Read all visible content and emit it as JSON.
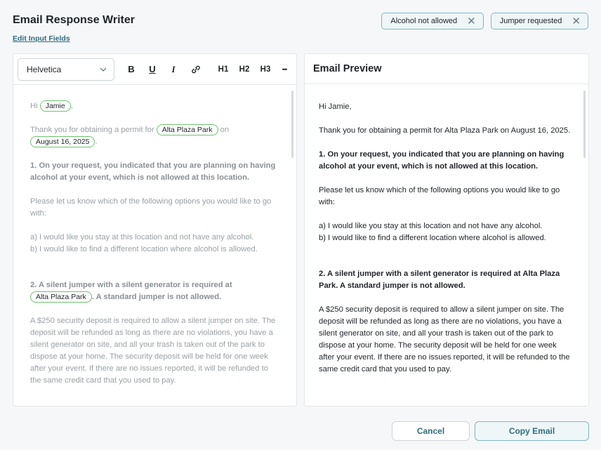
{
  "header": {
    "title": "Email Response Writer",
    "edit_link": "Edit Input Fields"
  },
  "chips": [
    {
      "label": "Alcohol not allowed"
    },
    {
      "label": "Jumper requested"
    }
  ],
  "editor": {
    "font": "Helvetica",
    "tools": {
      "bold": "B",
      "underline": "U",
      "italic": "I",
      "h1": "H1",
      "h2": "H2",
      "h3": "H3",
      "more": "•••"
    },
    "greeting_prefix": "Hi",
    "name_token": "Jamie",
    "greeting_suffix": ",",
    "intro_prefix": "Thank you for obtaining a permit for",
    "park_token": "Alta Plaza Park",
    "intro_mid": "on",
    "date_token": "August 16, 2025",
    "intro_suffix": ".",
    "item1": "1.  On your request, you indicated that you are planning on having alcohol at your event, which is not allowed at this location.",
    "options_intro": "Please let us know which of the following options you would like to go with:",
    "option_a": "a)  I would like you stay at this location and not have any alcohol.",
    "option_b": "b)  I would like to find a different location where alcohol is allowed.",
    "item2_prefix": "2.  A silent jumper with a silent generator is required at",
    "item2_park_token": "Alta Plaza Park",
    "item2_suffix": ".  A standard jumper is not allowed.",
    "deposit": "A $250 security deposit is required to allow a silent jumper on site. The deposit will be refunded as long as there are no violations, you have a silent generator on site, and all your trash is taken out of the park to dispose at your home. The security deposit will be held for one week after your event. If there are no issues reported, it will be refunded to the same credit card that you used to pay."
  },
  "preview": {
    "title": "Email Preview",
    "greeting": "Hi Jamie,",
    "intro": "Thank you for obtaining a permit for Alta Plaza Park on August 16, 2025.",
    "item1": "1.  On your request, you indicated that you are planning on having alcohol at your event, which is not allowed at this location.",
    "options_intro": "Please let us know which of the following options you would like to go with:",
    "option_a": "a)  I would like you stay at this location and not have any alcohol.",
    "option_b": "b)  I would like to find a different location where alcohol is allowed.",
    "item2": "2.  A silent jumper with a silent generator is required at Alta Plaza Park.  A standard jumper is not allowed.",
    "deposit": "A $250 security deposit is required to allow a silent jumper on site. The deposit will be refunded as long as there are no violations, you have a silent generator on site, and all your trash is taken out of the park to dispose at your home. The security deposit will be held for one week after your event. If there are no issues reported, it will be refunded to the same credit card that you used to pay."
  },
  "actions": {
    "cancel": "Cancel",
    "copy": "Copy Email"
  },
  "colors": {
    "accent": "#2f6d7f",
    "token_border": "#6cc36c",
    "chip_border": "#7fb6c6"
  }
}
